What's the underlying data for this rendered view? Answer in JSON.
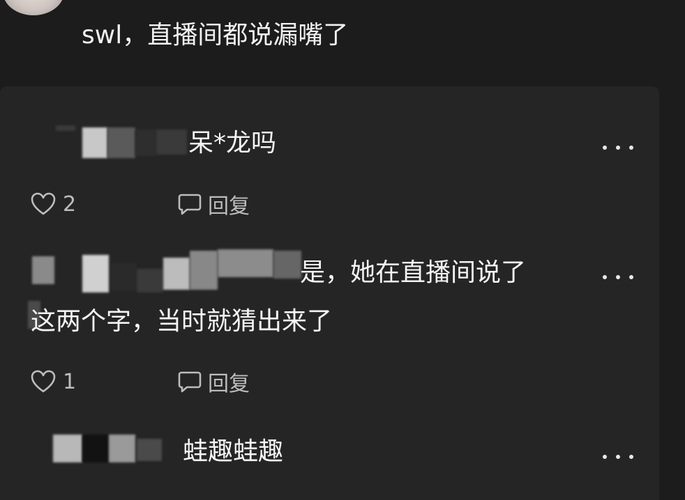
{
  "main_comment": {
    "text": "swl，直播间都说漏嘴了"
  },
  "replies": [
    {
      "text": "呆*龙吗",
      "likes": "2",
      "reply_label": "回复"
    },
    {
      "line1": "是，她在直播间说了",
      "line2": "这两个字，当时就猜出来了",
      "likes": "1",
      "reply_label": "回复"
    },
    {
      "text": "蛙趣蛙趣"
    }
  ],
  "icons": {
    "like": "heart-outline-icon",
    "reply": "speech-bubble-icon",
    "more": "three-dots-icon"
  },
  "colors": {
    "background": "#1c1c1c",
    "panel": "#252525",
    "text": "#f4f4f4",
    "muted": "#bdbdbd"
  }
}
